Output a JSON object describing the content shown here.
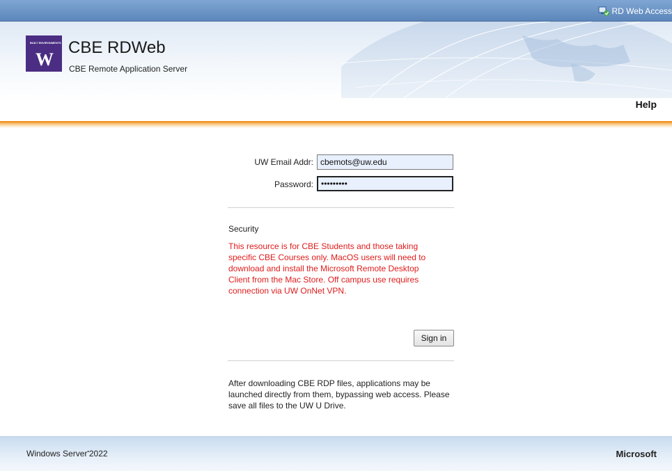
{
  "topbar": {
    "app_label": "RD Web Access",
    "icon": "rd-web-access-icon"
  },
  "header": {
    "logo_small_text": "BUILT ENVIRONMENTS",
    "logo_letter": "W",
    "title": "CBE RDWeb",
    "subtitle": "CBE Remote Application Server",
    "help_label": "Help"
  },
  "form": {
    "email_label": "UW Email Addr:",
    "email_value": "cbemots@uw.edu",
    "password_label": "Password:",
    "password_value": "•••••••••",
    "security_title": "Security",
    "security_text": "This resource is for CBE Students and those taking specific CBE Courses only. MacOS users will need to download and install the Microsoft Remote Desktop Client from the Mac Store. Off campus use requires connection via UW OnNet VPN.",
    "sign_in_label": "Sign in",
    "after_text": "After downloading CBE RDP files, applications may be launched directly from them, bypassing web access. Please save all files to the UW U Drive."
  },
  "footer": {
    "product": "Windows Server",
    "product_version": "2022",
    "brand": "Microsoft"
  },
  "colors": {
    "accent_orange": "#ef8f1c",
    "uw_purple": "#4b2e83",
    "warning_red": "#e01b1b"
  }
}
